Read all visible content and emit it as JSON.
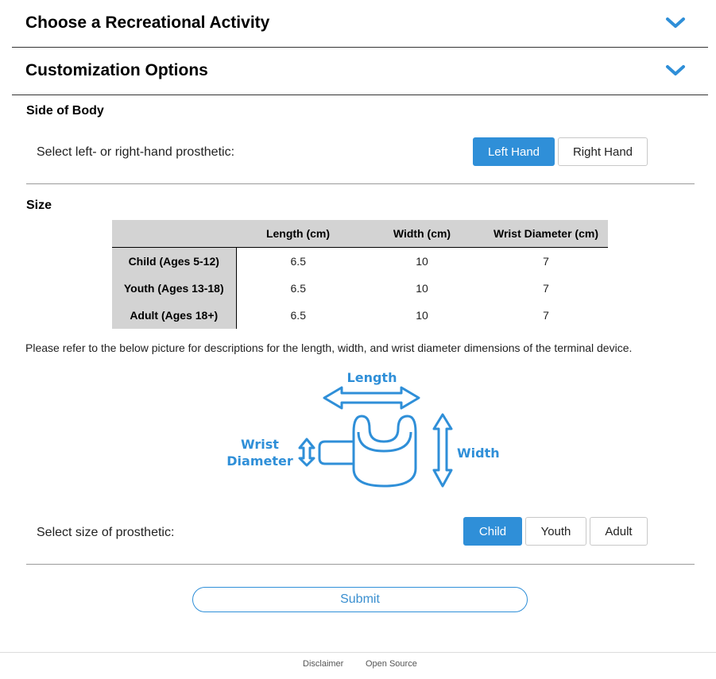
{
  "accordion": [
    {
      "title": "Choose a Recreational Activity"
    },
    {
      "title": "Customization Options"
    }
  ],
  "side_of_body": {
    "label": "Side of Body",
    "prompt": "Select left- or right-hand prosthetic:",
    "options": [
      "Left Hand",
      "Right Hand"
    ],
    "selected": "Left Hand"
  },
  "size": {
    "label": "Size",
    "table": {
      "headers": [
        "",
        "Length (cm)",
        "Width (cm)",
        "Wrist Diameter (cm)"
      ],
      "rows": [
        {
          "name": "Child (Ages 5-12)",
          "values": [
            "6.5",
            "10",
            "7"
          ]
        },
        {
          "name": "Youth (Ages 13-18)",
          "values": [
            "6.5",
            "10",
            "7"
          ]
        },
        {
          "name": "Adult (Ages 18+)",
          "values": [
            "6.5",
            "10",
            "7"
          ]
        }
      ]
    },
    "note": "Please refer to the below picture for descriptions for the length, width, and wrist diameter dimensions of the terminal device.",
    "diagram": {
      "length_label": "Length",
      "width_label": "Width",
      "wrist_label_line1": "Wrist",
      "wrist_label_line2": "Diameter",
      "color": "#2f8fd8"
    },
    "prompt": "Select size of prosthetic:",
    "options": [
      "Child",
      "Youth",
      "Adult"
    ],
    "selected": "Child"
  },
  "submit_label": "Submit",
  "footer": {
    "links": [
      "Disclaimer",
      "Open Source"
    ]
  },
  "colors": {
    "accent": "#2f8fd8",
    "table_header": "#d3d3d3"
  }
}
